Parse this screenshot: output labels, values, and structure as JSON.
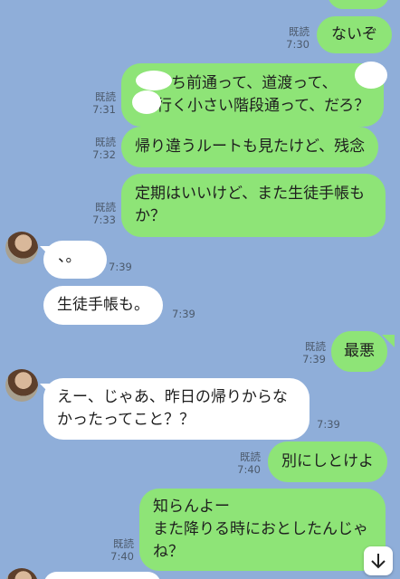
{
  "read_label": "既読",
  "messages": [
    {
      "text": "ないぞ",
      "time": "7:30"
    },
    {
      "text": "〇〇ち前通って、道渡って、〇〇行く小さい階段通って、だろ？",
      "line1": "ち前通って、道渡って、",
      "line2": "行く小さい階段通って、だろ？",
      "time": "7:31"
    },
    {
      "text": "帰り違うルートも見たけど、残念",
      "time": "7:32"
    },
    {
      "text": "定期はいいけど、また生徒手帳もか？",
      "line1": "定期はいいけど、また生徒手帳も",
      "line2": "か？",
      "time": "7:33"
    },
    {
      "text": "、。",
      "time": "7:39"
    },
    {
      "text": "生徒手帳も。",
      "time": "7:39"
    },
    {
      "text": "最悪",
      "time": "7:39"
    },
    {
      "text": "えー、じゃあ、昨日の帰りからなかったってこと？？",
      "line1": "えー、じゃあ、昨日の帰りからな",
      "line2": "かったってこと？？",
      "time": "7:39"
    },
    {
      "text": "別にしとけよ",
      "time": "7:40"
    },
    {
      "text": "知らんよー\nまた降りる時におとしたんじゃね？",
      "line1": "知らんよー",
      "line2": "また降りる時におとしたんじゃ",
      "line3": "ね？",
      "time": "7:40"
    }
  ],
  "icons": {
    "scroll_down": "arrow-down-icon"
  }
}
